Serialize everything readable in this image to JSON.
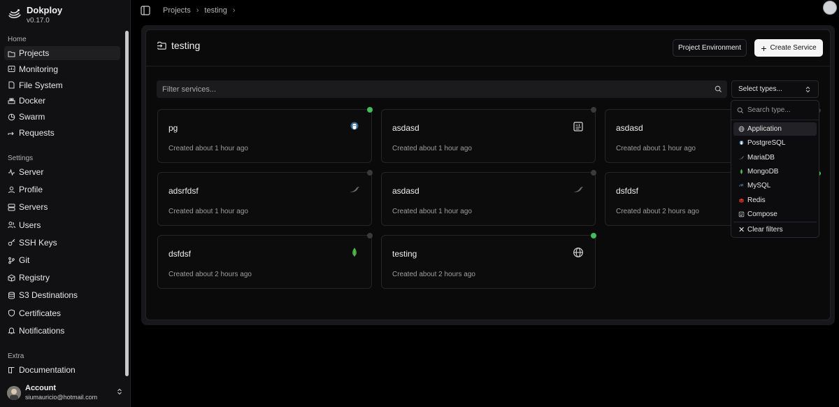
{
  "brand": {
    "name": "Dokploy",
    "version": "v0.17.0"
  },
  "sidebar": {
    "home_label": "Home",
    "home_items": [
      {
        "label": "Projects",
        "icon": "folder-icon",
        "active": true
      },
      {
        "label": "Monitoring",
        "icon": "chart-icon"
      },
      {
        "label": "File System",
        "icon": "file-icon"
      },
      {
        "label": "Docker",
        "icon": "docker-icon"
      },
      {
        "label": "Swarm",
        "icon": "pie-icon"
      },
      {
        "label": "Requests",
        "icon": "arrow-icon"
      }
    ],
    "settings_label": "Settings",
    "settings_items": [
      {
        "label": "Server",
        "icon": "activity-icon"
      },
      {
        "label": "Profile",
        "icon": "user-icon"
      },
      {
        "label": "Servers",
        "icon": "server-icon"
      },
      {
        "label": "Users",
        "icon": "users-icon"
      },
      {
        "label": "SSH Keys",
        "icon": "key-icon"
      },
      {
        "label": "Git",
        "icon": "git-icon"
      },
      {
        "label": "Registry",
        "icon": "package-icon"
      },
      {
        "label": "S3 Destinations",
        "icon": "database-icon"
      },
      {
        "label": "Certificates",
        "icon": "shield-icon"
      },
      {
        "label": "Notifications",
        "icon": "bell-icon"
      }
    ],
    "extra_label": "Extra",
    "extra_items": [
      {
        "label": "Documentation",
        "icon": "book-icon"
      }
    ]
  },
  "account": {
    "name": "Account",
    "email": "siumauricio@hotmail.com"
  },
  "breadcrumb": [
    "Projects",
    "testing"
  ],
  "page": {
    "title": "testing",
    "env_button": "Project Environment",
    "create_button": "Create Service",
    "filter_placeholder": "Filter services...",
    "select_label": "Select types..."
  },
  "services": [
    {
      "name": "pg",
      "meta": "Created about 1 hour ago",
      "icon": "postgres-icon",
      "status": "running"
    },
    {
      "name": "asdasd",
      "meta": "Created about 1 hour ago",
      "icon": "compose-icon",
      "status": "idle"
    },
    {
      "name": "asdasd",
      "meta": "Created about 1 hour ago",
      "icon": "",
      "status": "idle"
    },
    {
      "name": "adsrfdsf",
      "meta": "Created about 1 hour ago",
      "icon": "mariadb-icon",
      "status": "idle"
    },
    {
      "name": "asdasd",
      "meta": "Created about 1 hour ago",
      "icon": "mariadb-icon",
      "status": "idle"
    },
    {
      "name": "dsfdsf",
      "meta": "Created about 2 hours ago",
      "icon": "",
      "status": "running"
    },
    {
      "name": "dsfdsf",
      "meta": "Created about 2 hours ago",
      "icon": "mongodb-icon",
      "status": "idle"
    },
    {
      "name": "testing",
      "meta": "Created about 2 hours ago",
      "icon": "globe-icon",
      "status": "running"
    }
  ],
  "dropdown": {
    "search_placeholder": "Search type...",
    "items": [
      {
        "label": "Application",
        "icon": "globe-icon",
        "active": true
      },
      {
        "label": "PostgreSQL",
        "icon": "postgres-icon"
      },
      {
        "label": "MariaDB",
        "icon": "mariadb-icon"
      },
      {
        "label": "MongoDB",
        "icon": "mongodb-icon"
      },
      {
        "label": "MySQL",
        "icon": "mysql-icon"
      },
      {
        "label": "Redis",
        "icon": "redis-icon"
      },
      {
        "label": "Compose",
        "icon": "compose-icon"
      }
    ],
    "clear_label": "Clear filters"
  },
  "colors": {
    "running": "#3fbe5a",
    "idle": "#3a3a3d",
    "accent": "#f5f5f5"
  }
}
